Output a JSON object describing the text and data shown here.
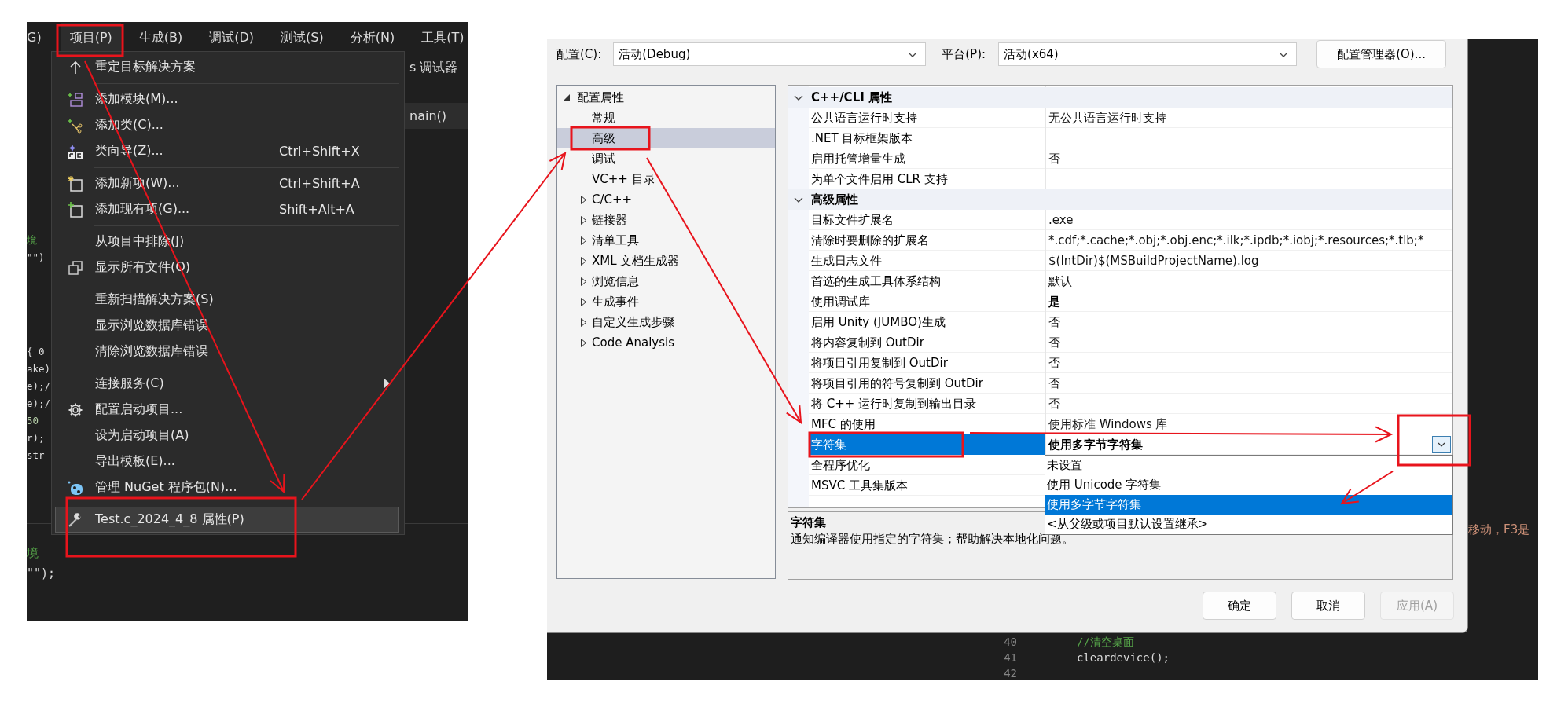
{
  "ide": {
    "menubar": [
      {
        "label": "G)",
        "selected": false
      },
      {
        "label": "项目(P)",
        "selected": true
      },
      {
        "label": "生成(B)",
        "selected": false
      },
      {
        "label": "调试(D)",
        "selected": false
      },
      {
        "label": "测试(S)",
        "selected": false
      },
      {
        "label": "分析(N)",
        "selected": false
      },
      {
        "label": "工具(T)",
        "selected": false
      }
    ],
    "toolbar_text": "s 调试器",
    "tab_text": "nain()",
    "code_left_top": [
      "境",
      "\"\")"
    ],
    "code_left_mid": [
      "{ 0",
      "ake)",
      "e);/",
      "e);/",
      "50",
      "r);",
      "str"
    ],
    "code_bottom": [
      "境",
      "\"\");"
    ],
    "menu": [
      {
        "kind": "item",
        "label": "重定目标解决方案",
        "highlighted": false
      },
      {
        "kind": "separator"
      },
      {
        "kind": "item",
        "label": "添加模块(M)...",
        "highlighted": false
      },
      {
        "kind": "item",
        "label": "添加类(C)...",
        "highlighted": false
      },
      {
        "kind": "item",
        "label": "类向导(Z)...",
        "shortcut": "Ctrl+Shift+X",
        "highlighted": false
      },
      {
        "kind": "separator"
      },
      {
        "kind": "item",
        "label": "添加新项(W)...",
        "shortcut": "Ctrl+Shift+A",
        "highlighted": false
      },
      {
        "kind": "item",
        "label": "添加现有项(G)...",
        "shortcut": "Shift+Alt+A",
        "highlighted": false
      },
      {
        "kind": "separator"
      },
      {
        "kind": "item",
        "label": "从项目中排除(J)",
        "highlighted": false
      },
      {
        "kind": "item",
        "label": "显示所有文件(O)",
        "highlighted": false
      },
      {
        "kind": "separator"
      },
      {
        "kind": "item",
        "label": "重新扫描解决方案(S)",
        "highlighted": false
      },
      {
        "kind": "item",
        "label": "显示浏览数据库错误",
        "highlighted": false
      },
      {
        "kind": "item",
        "label": "清除浏览数据库错误",
        "highlighted": false
      },
      {
        "kind": "separator"
      },
      {
        "kind": "item",
        "label": "连接服务(C)",
        "submenu": true,
        "highlighted": false
      },
      {
        "kind": "item",
        "label": "配置启动项目...",
        "highlighted": false
      },
      {
        "kind": "item",
        "label": "设为启动项目(A)",
        "highlighted": false
      },
      {
        "kind": "item",
        "label": "导出模板(E)...",
        "highlighted": false
      },
      {
        "kind": "item",
        "label": "管理 NuGet 程序包(N)...",
        "highlighted": false
      },
      {
        "kind": "separator"
      },
      {
        "kind": "item",
        "label": "Test.c_2024_4_8 属性(P)",
        "highlighted": true
      }
    ]
  },
  "dialog": {
    "config_label": "配置(C):",
    "config_value": "活动(Debug)",
    "platform_label": "平台(P):",
    "platform_value": "活动(x64)",
    "manager_button": "配置管理器(O)...",
    "tree": {
      "label": "配置属性",
      "expanded": true,
      "selected": false,
      "children": [
        {
          "label": "常规",
          "kind": "leaf",
          "selected": false
        },
        {
          "label": "高级",
          "kind": "leaf",
          "selected": true
        },
        {
          "label": "调试",
          "kind": "leaf",
          "selected": false
        },
        {
          "label": "VC++ 目录",
          "kind": "leaf",
          "selected": false
        },
        {
          "label": "C/C++",
          "kind": "group",
          "expanded": false,
          "selected": false
        },
        {
          "label": "链接器",
          "kind": "group",
          "expanded": false,
          "selected": false
        },
        {
          "label": "清单工具",
          "kind": "group",
          "expanded": false,
          "selected": false
        },
        {
          "label": "XML 文档生成器",
          "kind": "group",
          "expanded": false,
          "selected": false
        },
        {
          "label": "浏览信息",
          "kind": "group",
          "expanded": false,
          "selected": false
        },
        {
          "label": "生成事件",
          "kind": "group",
          "expanded": false,
          "selected": false
        },
        {
          "label": "自定义生成步骤",
          "kind": "group",
          "expanded": false,
          "selected": false
        },
        {
          "label": "Code Analysis",
          "kind": "group",
          "expanded": false,
          "selected": false
        }
      ]
    },
    "sections": [
      {
        "title": "C++/CLI 属性",
        "expanded": true,
        "rows": [
          {
            "name": "公共语言运行时支持",
            "value": "无公共语言运行时支持",
            "modified": false,
            "selected": false
          },
          {
            "name": ".NET 目标框架版本",
            "selected": false
          },
          {
            "name": "启用托管增量生成",
            "value": "否",
            "modified": false,
            "selected": false
          },
          {
            "name": "为单个文件启用 CLR 支持",
            "selected": false
          }
        ]
      },
      {
        "title": "高级属性",
        "expanded": true,
        "rows": [
          {
            "name": "目标文件扩展名",
            "value": ".exe",
            "modified": false,
            "selected": false
          },
          {
            "name": "清除时要删除的扩展名",
            "value": "*.cdf;*.cache;*.obj;*.obj.enc;*.ilk;*.ipdb;*.iobj;*.resources;*.tlb;*",
            "modified": false,
            "selected": false
          },
          {
            "name": "生成日志文件",
            "value": "$(IntDir)$(MSBuildProjectName).log",
            "modified": false,
            "selected": false
          },
          {
            "name": "首选的生成工具体系结构",
            "value": "默认",
            "modified": false,
            "selected": false
          },
          {
            "name": "使用调试库",
            "value": "是",
            "modified": true,
            "selected": false
          },
          {
            "name": "启用 Unity (JUMBO)生成",
            "value": "否",
            "modified": false,
            "selected": false
          },
          {
            "name": "将内容复制到 OutDir",
            "value": "否",
            "modified": false,
            "selected": false
          },
          {
            "name": "将项目引用复制到 OutDir",
            "value": "否",
            "modified": false,
            "selected": false
          },
          {
            "name": "将项目引用的符号复制到 OutDir",
            "value": "否",
            "modified": false,
            "selected": false
          },
          {
            "name": "将 C++ 运行时复制到输出目录",
            "value": "否",
            "modified": false,
            "selected": false
          },
          {
            "name": "MFC 的使用",
            "value": "使用标准 Windows 库",
            "modified": false,
            "selected": false
          },
          {
            "name": "字符集",
            "value": "使用多字节字符集",
            "modified": true,
            "selected": true,
            "options": [
              {
                "label": "未设置",
                "selected": false
              },
              {
                "label": "使用 Unicode 字符集",
                "selected": false
              },
              {
                "label": "使用多字节字符集",
                "selected": true
              },
              {
                "label": "<从父级或项目默认设置继承>",
                "selected": false
              }
            ]
          },
          {
            "name": "全程序优化",
            "selected": false
          },
          {
            "name": "MSVC 工具集版本",
            "selected": false
          }
        ]
      }
    ],
    "description": {
      "title": "字符集",
      "text": "通知编译器使用指定的字符集；帮助解决本地化问题。"
    },
    "buttons": [
      {
        "label": "确定",
        "disabled": false
      },
      {
        "label": "取消",
        "disabled": false
      },
      {
        "label": "应用(A)",
        "disabled": true
      }
    ]
  },
  "editor": {
    "lines": [
      {
        "number": "40",
        "code": "//清空桌面",
        "kind": "comment"
      },
      {
        "number": "41",
        "code": "cleardevice();",
        "kind": "code"
      },
      {
        "number": "42"
      }
    ],
    "side_text": "移动，F3是"
  }
}
